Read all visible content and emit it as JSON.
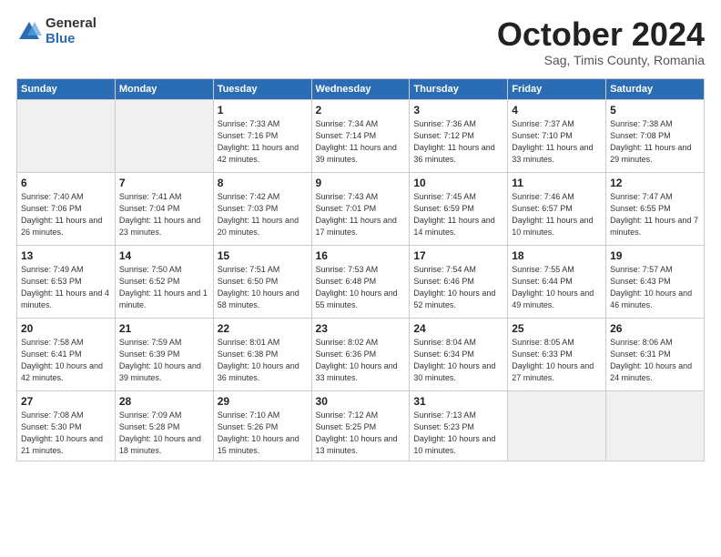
{
  "logo": {
    "general": "General",
    "blue": "Blue"
  },
  "title": "October 2024",
  "subtitle": "Sag, Timis County, Romania",
  "headers": [
    "Sunday",
    "Monday",
    "Tuesday",
    "Wednesday",
    "Thursday",
    "Friday",
    "Saturday"
  ],
  "weeks": [
    [
      {
        "num": "",
        "info": ""
      },
      {
        "num": "",
        "info": ""
      },
      {
        "num": "1",
        "info": "Sunrise: 7:33 AM\nSunset: 7:16 PM\nDaylight: 11 hours and 42 minutes."
      },
      {
        "num": "2",
        "info": "Sunrise: 7:34 AM\nSunset: 7:14 PM\nDaylight: 11 hours and 39 minutes."
      },
      {
        "num": "3",
        "info": "Sunrise: 7:36 AM\nSunset: 7:12 PM\nDaylight: 11 hours and 36 minutes."
      },
      {
        "num": "4",
        "info": "Sunrise: 7:37 AM\nSunset: 7:10 PM\nDaylight: 11 hours and 33 minutes."
      },
      {
        "num": "5",
        "info": "Sunrise: 7:38 AM\nSunset: 7:08 PM\nDaylight: 11 hours and 29 minutes."
      }
    ],
    [
      {
        "num": "6",
        "info": "Sunrise: 7:40 AM\nSunset: 7:06 PM\nDaylight: 11 hours and 26 minutes."
      },
      {
        "num": "7",
        "info": "Sunrise: 7:41 AM\nSunset: 7:04 PM\nDaylight: 11 hours and 23 minutes."
      },
      {
        "num": "8",
        "info": "Sunrise: 7:42 AM\nSunset: 7:03 PM\nDaylight: 11 hours and 20 minutes."
      },
      {
        "num": "9",
        "info": "Sunrise: 7:43 AM\nSunset: 7:01 PM\nDaylight: 11 hours and 17 minutes."
      },
      {
        "num": "10",
        "info": "Sunrise: 7:45 AM\nSunset: 6:59 PM\nDaylight: 11 hours and 14 minutes."
      },
      {
        "num": "11",
        "info": "Sunrise: 7:46 AM\nSunset: 6:57 PM\nDaylight: 11 hours and 10 minutes."
      },
      {
        "num": "12",
        "info": "Sunrise: 7:47 AM\nSunset: 6:55 PM\nDaylight: 11 hours and 7 minutes."
      }
    ],
    [
      {
        "num": "13",
        "info": "Sunrise: 7:49 AM\nSunset: 6:53 PM\nDaylight: 11 hours and 4 minutes."
      },
      {
        "num": "14",
        "info": "Sunrise: 7:50 AM\nSunset: 6:52 PM\nDaylight: 11 hours and 1 minute."
      },
      {
        "num": "15",
        "info": "Sunrise: 7:51 AM\nSunset: 6:50 PM\nDaylight: 10 hours and 58 minutes."
      },
      {
        "num": "16",
        "info": "Sunrise: 7:53 AM\nSunset: 6:48 PM\nDaylight: 10 hours and 55 minutes."
      },
      {
        "num": "17",
        "info": "Sunrise: 7:54 AM\nSunset: 6:46 PM\nDaylight: 10 hours and 52 minutes."
      },
      {
        "num": "18",
        "info": "Sunrise: 7:55 AM\nSunset: 6:44 PM\nDaylight: 10 hours and 49 minutes."
      },
      {
        "num": "19",
        "info": "Sunrise: 7:57 AM\nSunset: 6:43 PM\nDaylight: 10 hours and 46 minutes."
      }
    ],
    [
      {
        "num": "20",
        "info": "Sunrise: 7:58 AM\nSunset: 6:41 PM\nDaylight: 10 hours and 42 minutes."
      },
      {
        "num": "21",
        "info": "Sunrise: 7:59 AM\nSunset: 6:39 PM\nDaylight: 10 hours and 39 minutes."
      },
      {
        "num": "22",
        "info": "Sunrise: 8:01 AM\nSunset: 6:38 PM\nDaylight: 10 hours and 36 minutes."
      },
      {
        "num": "23",
        "info": "Sunrise: 8:02 AM\nSunset: 6:36 PM\nDaylight: 10 hours and 33 minutes."
      },
      {
        "num": "24",
        "info": "Sunrise: 8:04 AM\nSunset: 6:34 PM\nDaylight: 10 hours and 30 minutes."
      },
      {
        "num": "25",
        "info": "Sunrise: 8:05 AM\nSunset: 6:33 PM\nDaylight: 10 hours and 27 minutes."
      },
      {
        "num": "26",
        "info": "Sunrise: 8:06 AM\nSunset: 6:31 PM\nDaylight: 10 hours and 24 minutes."
      }
    ],
    [
      {
        "num": "27",
        "info": "Sunrise: 7:08 AM\nSunset: 5:30 PM\nDaylight: 10 hours and 21 minutes."
      },
      {
        "num": "28",
        "info": "Sunrise: 7:09 AM\nSunset: 5:28 PM\nDaylight: 10 hours and 18 minutes."
      },
      {
        "num": "29",
        "info": "Sunrise: 7:10 AM\nSunset: 5:26 PM\nDaylight: 10 hours and 15 minutes."
      },
      {
        "num": "30",
        "info": "Sunrise: 7:12 AM\nSunset: 5:25 PM\nDaylight: 10 hours and 13 minutes."
      },
      {
        "num": "31",
        "info": "Sunrise: 7:13 AM\nSunset: 5:23 PM\nDaylight: 10 hours and 10 minutes."
      },
      {
        "num": "",
        "info": ""
      },
      {
        "num": "",
        "info": ""
      }
    ]
  ]
}
